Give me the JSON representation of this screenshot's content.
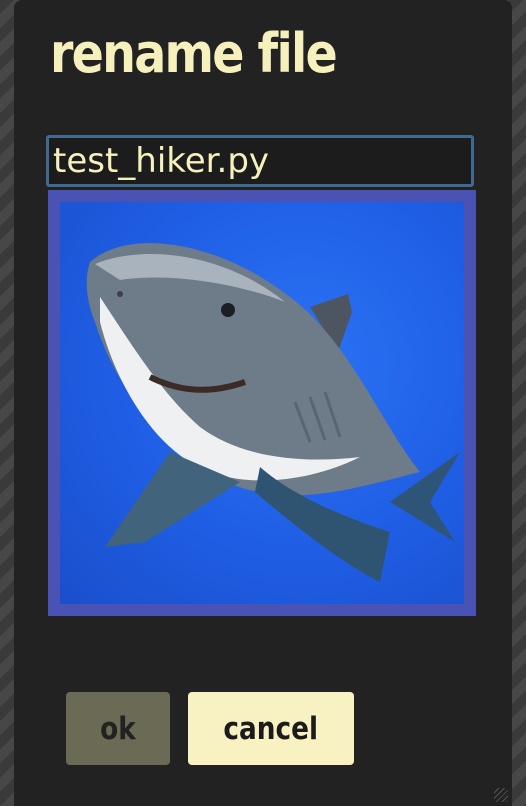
{
  "dialog": {
    "title": "rename file",
    "filename": "test_hiker.py",
    "preview": {
      "icon": "shark-image",
      "background_color": "#2066ec",
      "frame_color": "#4a52b4"
    },
    "buttons": {
      "ok_label": "ok",
      "cancel_label": "cancel"
    },
    "colors": {
      "title": "#f6f0bd",
      "input_border": "#3f6991",
      "ok_bg": "#6b6a55",
      "cancel_bg": "#f8f2c2"
    }
  }
}
